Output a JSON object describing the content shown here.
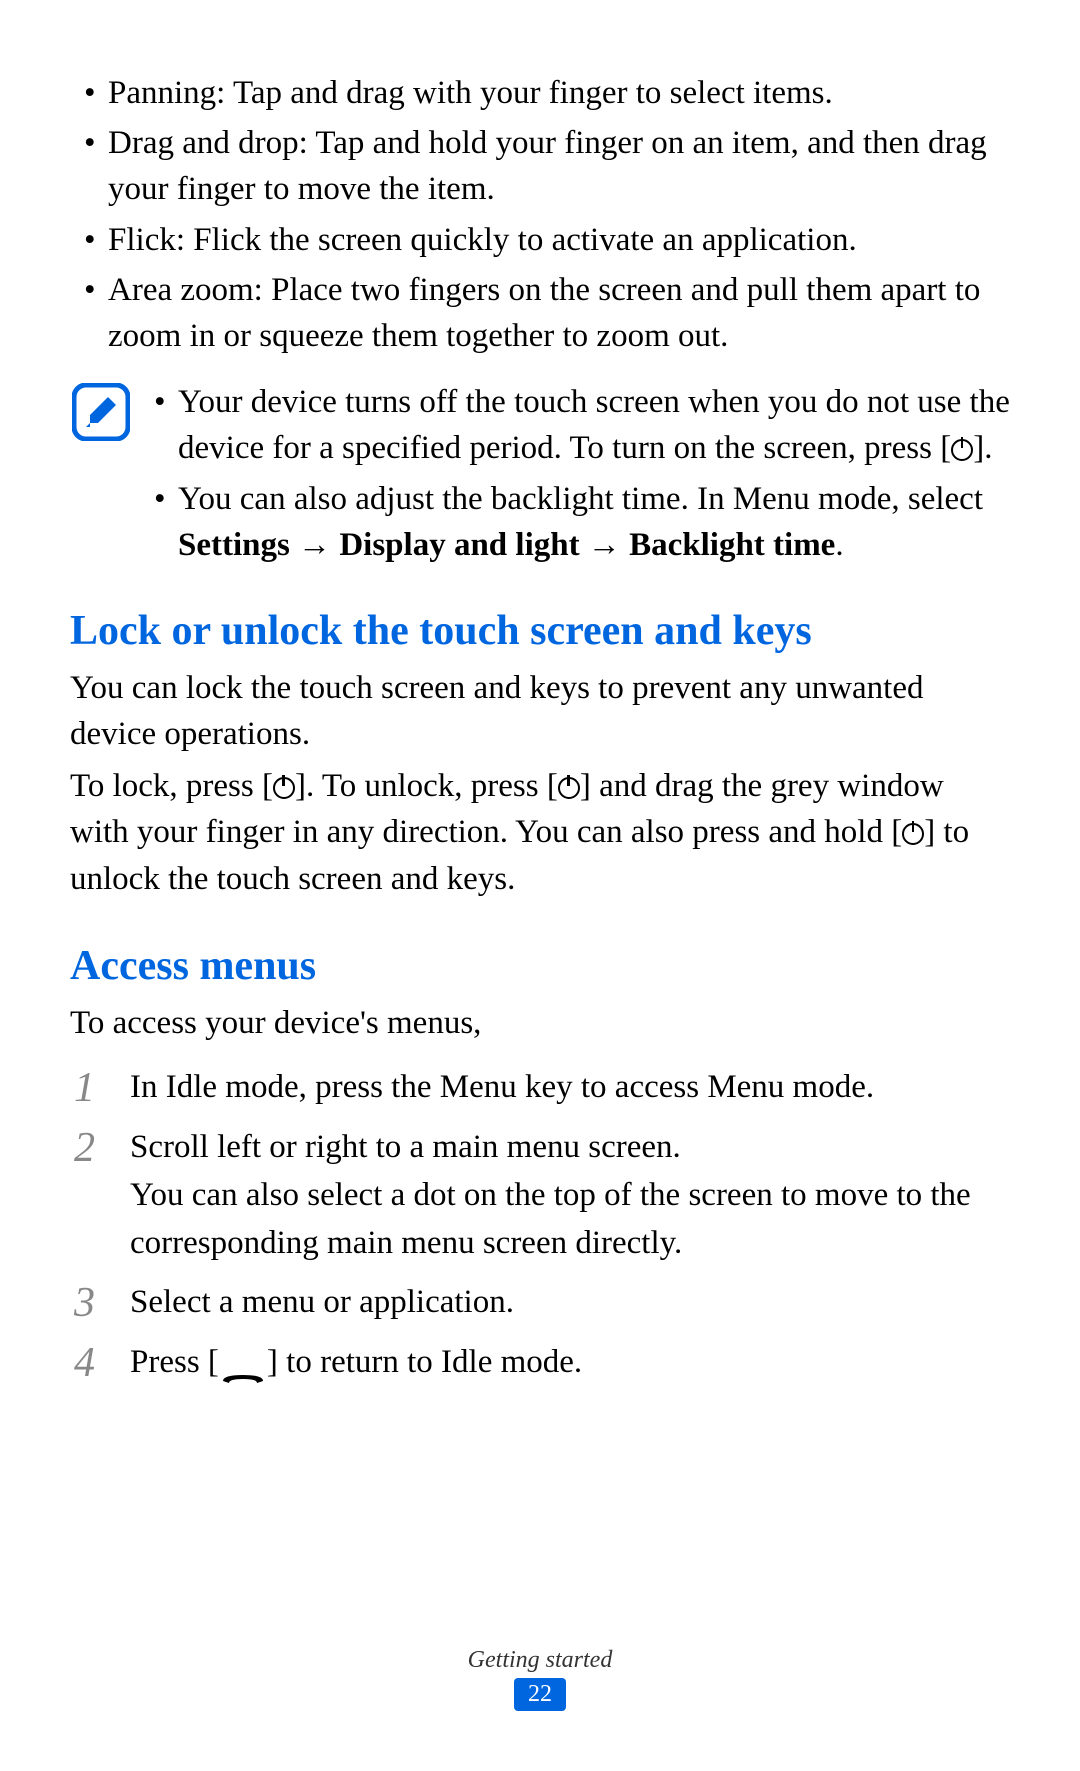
{
  "gestures": {
    "panning": "Panning: Tap and drag with your finger to select items.",
    "drag_drop": "Drag and drop: Tap and hold your finger on an item, and then drag your finger to move the item.",
    "flick": "Flick: Flick the screen quickly to activate an application.",
    "area_zoom": "Area zoom: Place two fingers on the screen and pull them apart to zoom in or squeeze them together to zoom out."
  },
  "note": {
    "line1_part1": "Your device turns off the touch screen when you do not use the device for a specified period. To turn on the screen, press [",
    "line1_part2": "].",
    "line2_part1": "You can also adjust the backlight time. In Menu mode, select ",
    "line2_bold1": "Settings",
    "line2_arrow1": " → ",
    "line2_bold2": "Display and light",
    "line2_arrow2": " → ",
    "line2_bold3": "Backlight time",
    "line2_part2": "."
  },
  "section1": {
    "heading": "Lock or unlock the touch screen and keys",
    "para1": "You can lock the touch screen and keys to prevent any unwanted device operations.",
    "para2_part1": "To lock, press [",
    "para2_part2": "]. To unlock, press [",
    "para2_part3": "] and drag the grey window with your finger in any direction. You can also press and hold [",
    "para2_part4": "] to unlock the touch screen and keys."
  },
  "section2": {
    "heading": "Access menus",
    "intro": "To access your device's menus,",
    "steps": {
      "num1": "1",
      "step1": "In Idle mode, press the Menu key to access Menu mode.",
      "num2": "2",
      "step2": "Scroll left or right to a main menu screen.\nYou can also select a dot on the top of the screen to move to the corresponding main menu screen directly.",
      "step2_line1": "Scroll left or right to a main menu screen.",
      "step2_line2": "You can also select a dot on the top of the screen to move to the corresponding main menu screen directly.",
      "num3": "3",
      "step3": "Select a menu or application.",
      "num4": "4",
      "step4_part1": "Press [",
      "step4_part2": "] to return to Idle mode."
    }
  },
  "footer": {
    "chapter": "Getting started",
    "page": "22"
  }
}
